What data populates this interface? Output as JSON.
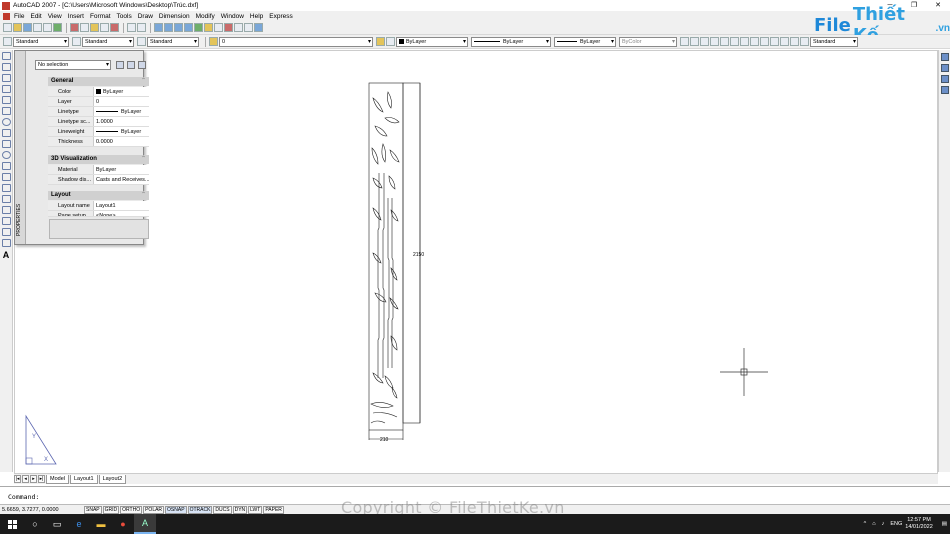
{
  "window": {
    "title": "AutoCAD 2007 - [C:\\Users\\Microsoft Windows\\Desktop\\Trúc.dxf]",
    "minimize": "─",
    "restore": "❐",
    "close": "✕"
  },
  "menu": [
    "File",
    "Edit",
    "View",
    "Insert",
    "Format",
    "Tools",
    "Draw",
    "Dimension",
    "Modify",
    "Window",
    "Help",
    "Express"
  ],
  "toolbars": {
    "text_style": "Standard",
    "dim_style": "Standard",
    "table_style": "Standard",
    "layer": "0",
    "color": "ByLayer",
    "linetype": "ByLayer",
    "lineweight": "ByLayer",
    "plotstyle": "ByColor",
    "right_style": "Standard"
  },
  "brand": {
    "part1": "File",
    "part2": "Thiết Kế",
    "part3": ".vn"
  },
  "properties": {
    "panel_title": "PROPERTIES",
    "selection": "No selection",
    "sections": {
      "general": "General",
      "visualization": "3D Visualization",
      "layout": "Layout"
    },
    "general": {
      "color_k": "Color",
      "color_v": "ByLayer",
      "layer_k": "Layer",
      "layer_v": "0",
      "linetype_k": "Linetype",
      "linetype_v": "ByLayer",
      "ltscale_k": "Linetype sc...",
      "ltscale_v": "1.0000",
      "lineweight_k": "Lineweight",
      "lineweight_v": "ByLayer",
      "thickness_k": "Thickness",
      "thickness_v": "0.0000"
    },
    "visualization": {
      "material_k": "Material",
      "material_v": "ByLayer",
      "shadow_k": "Shadow dis...",
      "shadow_v": "Casts and Receives..."
    },
    "layout": {
      "name_k": "Layout name",
      "name_v": "Layout1",
      "page_k": "Page setup...",
      "page_v": "<None>"
    }
  },
  "drawing": {
    "height_dim": "2150",
    "width_dim": "210"
  },
  "tabs": [
    "Model",
    "Layout1",
    "Layout2"
  ],
  "command": {
    "prompt": "Command:"
  },
  "status": {
    "coords": "5.6659, 3.7277, 0.0000",
    "buttons": [
      "SNAP",
      "GRID",
      "ORTHO",
      "POLAR",
      "OSNAP",
      "OTRACK",
      "DUCS",
      "DYN",
      "LWT",
      "PAPER"
    ]
  },
  "watermark": "Copyright © FileThietKe.vn",
  "taskbar": {
    "lang": "ENG",
    "time": "12:57 PM",
    "date": "14/01/2022"
  }
}
